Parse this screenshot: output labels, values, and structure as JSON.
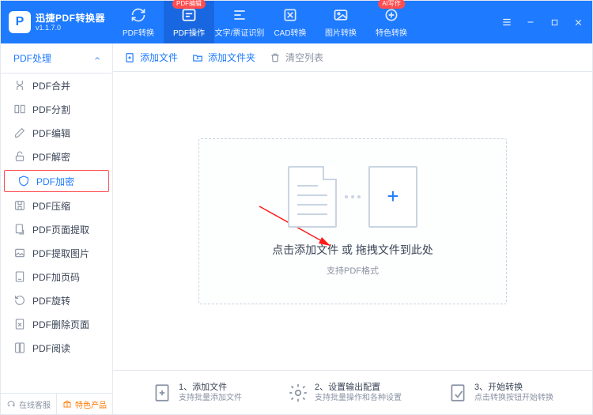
{
  "brand": {
    "name": "迅捷PDF转换器",
    "version": "v1.1.7.0"
  },
  "header": {
    "tabs": [
      {
        "label": "PDF转换",
        "chip": ""
      },
      {
        "label": "PDF操作",
        "chip": "PDF编辑"
      },
      {
        "label": "文字/票证识别",
        "chip": ""
      },
      {
        "label": "CAD转换",
        "chip": ""
      },
      {
        "label": "图片转换",
        "chip": ""
      },
      {
        "label": "特色转换",
        "chip": "AI写作"
      }
    ],
    "active_index": 1
  },
  "sidebar": {
    "title": "PDF处理",
    "items": [
      {
        "label": "PDF合并"
      },
      {
        "label": "PDF分割"
      },
      {
        "label": "PDF编辑"
      },
      {
        "label": "PDF解密"
      },
      {
        "label": "PDF加密"
      },
      {
        "label": "PDF压缩"
      },
      {
        "label": "PDF页面提取"
      },
      {
        "label": "PDF提取图片"
      },
      {
        "label": "PDF加页码"
      },
      {
        "label": "PDF旋转"
      },
      {
        "label": "PDF删除页面"
      },
      {
        "label": "PDF阅读"
      }
    ],
    "selected_index": 4,
    "footer": {
      "support": "在线客服",
      "featured": "特色产品"
    }
  },
  "toolbar": {
    "add_file": "添加文件",
    "add_folder": "添加文件夹",
    "clear": "清空列表"
  },
  "drop": {
    "title": "点击添加文件 或 拖拽文件到此处",
    "subtitle": "支持PDF格式"
  },
  "steps": [
    {
      "num": "1、",
      "title": "添加文件",
      "desc": "支持批量添加文件"
    },
    {
      "num": "2、",
      "title": "设置输出配置",
      "desc": "支持批量操作和各种设置"
    },
    {
      "num": "3、",
      "title": "开始转换",
      "desc": "点击转换按钮开始转换"
    }
  ]
}
